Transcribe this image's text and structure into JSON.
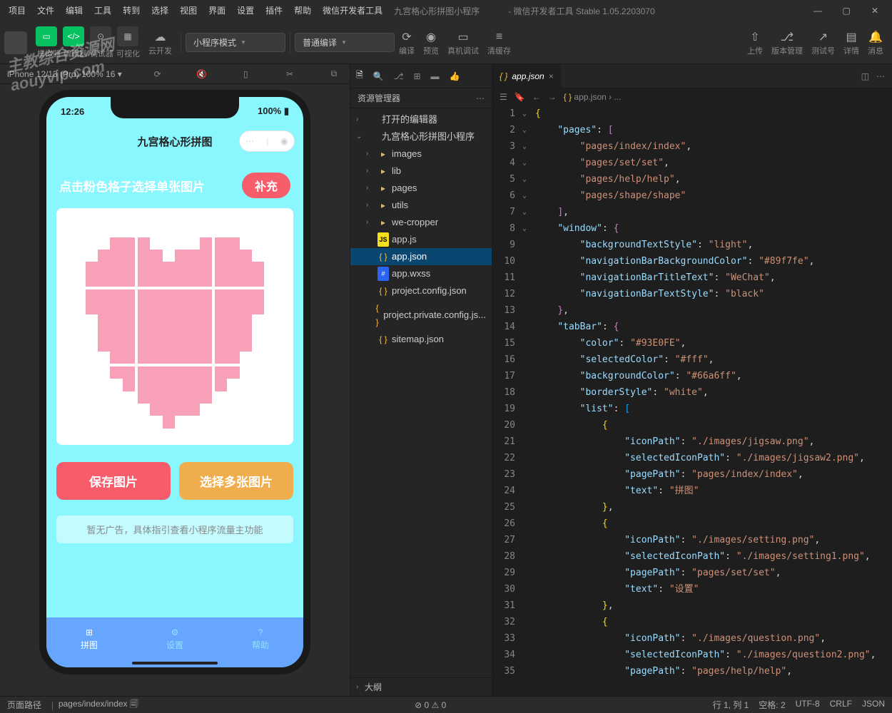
{
  "titlebar": {
    "menus": [
      "项目",
      "文件",
      "编辑",
      "工具",
      "转到",
      "选择",
      "视图",
      "界面",
      "设置",
      "插件",
      "帮助",
      "微信开发者工具"
    ],
    "projectName": "九宫格心形拼图小程序",
    "stable": "- 微信开发者工具 Stable 1.05.2203070"
  },
  "toolbar": {
    "modeLabels": [
      "模拟器",
      "编辑器",
      "调试器",
      "可视化"
    ],
    "cloudDev": "云开发",
    "programMode": "小程序模式",
    "compileMode": "普通编译",
    "actions": {
      "compile": "编译",
      "preview": "预览",
      "realDebug": "真机调试",
      "clearCache": "清缓存",
      "upload": "上传",
      "version": "版本管理",
      "testNum": "测试号",
      "details": "详情",
      "message": "消息"
    }
  },
  "sim": {
    "device": "iPhone 12/13 (Pro)",
    "zoom": "100% 16",
    "time": "12:26",
    "battery": "100%",
    "navTitle": "九宫格心形拼图",
    "hint": "点击粉色格子选择单张图片",
    "fillBtn": "补充",
    "saveBtn": "保存图片",
    "multiBtn": "选择多张图片",
    "adText": "暂无广告，具体指引查看小程序流量主功能",
    "tabs": [
      "拼图",
      "设置",
      "帮助"
    ]
  },
  "explorer": {
    "title": "资源管理器",
    "openEditors": "打开的编辑器",
    "projectRoot": "九宫格心形拼图小程序",
    "folders": [
      "images",
      "lib",
      "pages",
      "utils",
      "we-cropper"
    ],
    "files": [
      "app.js",
      "app.json",
      "app.wxss",
      "project.config.json",
      "project.private.config.js...",
      "sitemap.json"
    ],
    "outline": "大纲"
  },
  "editor": {
    "tabName": "app.json",
    "breadcrumbFile": "app.json",
    "breadcrumbMore": "..."
  },
  "code": {
    "lines": [
      [
        [
          "brace",
          "{"
        ]
      ],
      [
        [
          "sp",
          "    "
        ],
        [
          "key",
          "\"pages\""
        ],
        [
          "punc",
          ": "
        ],
        [
          "brace1",
          "["
        ]
      ],
      [
        [
          "sp",
          "        "
        ],
        [
          "str",
          "\"pages/index/index\""
        ],
        [
          "punc",
          ","
        ]
      ],
      [
        [
          "sp",
          "        "
        ],
        [
          "str",
          "\"pages/set/set\""
        ],
        [
          "punc",
          ","
        ]
      ],
      [
        [
          "sp",
          "        "
        ],
        [
          "str",
          "\"pages/help/help\""
        ],
        [
          "punc",
          ","
        ]
      ],
      [
        [
          "sp",
          "        "
        ],
        [
          "str",
          "\"pages/shape/shape\""
        ]
      ],
      [
        [
          "sp",
          "    "
        ],
        [
          "brace1",
          "]"
        ],
        [
          "punc",
          ","
        ]
      ],
      [
        [
          "sp",
          "    "
        ],
        [
          "key",
          "\"window\""
        ],
        [
          "punc",
          ": "
        ],
        [
          "brace1",
          "{"
        ]
      ],
      [
        [
          "sp",
          "        "
        ],
        [
          "key",
          "\"backgroundTextStyle\""
        ],
        [
          "punc",
          ": "
        ],
        [
          "str",
          "\"light\""
        ],
        [
          "punc",
          ","
        ]
      ],
      [
        [
          "sp",
          "        "
        ],
        [
          "key",
          "\"navigationBarBackgroundColor\""
        ],
        [
          "punc",
          ": "
        ],
        [
          "str",
          "\"#89f7fe\""
        ],
        [
          "punc",
          ","
        ]
      ],
      [
        [
          "sp",
          "        "
        ],
        [
          "key",
          "\"navigationBarTitleText\""
        ],
        [
          "punc",
          ": "
        ],
        [
          "str",
          "\"WeChat\""
        ],
        [
          "punc",
          ","
        ]
      ],
      [
        [
          "sp",
          "        "
        ],
        [
          "key",
          "\"navigationBarTextStyle\""
        ],
        [
          "punc",
          ": "
        ],
        [
          "str",
          "\"black\""
        ]
      ],
      [
        [
          "sp",
          "    "
        ],
        [
          "brace1",
          "}"
        ],
        [
          "punc",
          ","
        ]
      ],
      [
        [
          "sp",
          "    "
        ],
        [
          "key",
          "\"tabBar\""
        ],
        [
          "punc",
          ": "
        ],
        [
          "brace1",
          "{"
        ]
      ],
      [
        [
          "sp",
          "        "
        ],
        [
          "key",
          "\"color\""
        ],
        [
          "punc",
          ": "
        ],
        [
          "str",
          "\"#93E0FE\""
        ],
        [
          "punc",
          ","
        ]
      ],
      [
        [
          "sp",
          "        "
        ],
        [
          "key",
          "\"selectedColor\""
        ],
        [
          "punc",
          ": "
        ],
        [
          "str",
          "\"#fff\""
        ],
        [
          "punc",
          ","
        ]
      ],
      [
        [
          "sp",
          "        "
        ],
        [
          "key",
          "\"backgroundColor\""
        ],
        [
          "punc",
          ": "
        ],
        [
          "str",
          "\"#66a6ff\""
        ],
        [
          "punc",
          ","
        ]
      ],
      [
        [
          "sp",
          "        "
        ],
        [
          "key",
          "\"borderStyle\""
        ],
        [
          "punc",
          ": "
        ],
        [
          "str",
          "\"white\""
        ],
        [
          "punc",
          ","
        ]
      ],
      [
        [
          "sp",
          "        "
        ],
        [
          "key",
          "\"list\""
        ],
        [
          "punc",
          ": "
        ],
        [
          "brace2",
          "["
        ]
      ],
      [
        [
          "sp",
          "            "
        ],
        [
          "brace",
          "{"
        ]
      ],
      [
        [
          "sp",
          "                "
        ],
        [
          "key",
          "\"iconPath\""
        ],
        [
          "punc",
          ": "
        ],
        [
          "str",
          "\"./images/jigsaw.png\""
        ],
        [
          "punc",
          ","
        ]
      ],
      [
        [
          "sp",
          "                "
        ],
        [
          "key",
          "\"selectedIconPath\""
        ],
        [
          "punc",
          ": "
        ],
        [
          "str",
          "\"./images/jigsaw2.png\""
        ],
        [
          "punc",
          ","
        ]
      ],
      [
        [
          "sp",
          "                "
        ],
        [
          "key",
          "\"pagePath\""
        ],
        [
          "punc",
          ": "
        ],
        [
          "str",
          "\"pages/index/index\""
        ],
        [
          "punc",
          ","
        ]
      ],
      [
        [
          "sp",
          "                "
        ],
        [
          "key",
          "\"text\""
        ],
        [
          "punc",
          ": "
        ],
        [
          "str",
          "\"拼图\""
        ]
      ],
      [
        [
          "sp",
          "            "
        ],
        [
          "brace",
          "}"
        ],
        [
          "punc",
          ","
        ]
      ],
      [
        [
          "sp",
          "            "
        ],
        [
          "brace",
          "{"
        ]
      ],
      [
        [
          "sp",
          "                "
        ],
        [
          "key",
          "\"iconPath\""
        ],
        [
          "punc",
          ": "
        ],
        [
          "str",
          "\"./images/setting.png\""
        ],
        [
          "punc",
          ","
        ]
      ],
      [
        [
          "sp",
          "                "
        ],
        [
          "key",
          "\"selectedIconPath\""
        ],
        [
          "punc",
          ": "
        ],
        [
          "str",
          "\"./images/setting1.png\""
        ],
        [
          "punc",
          ","
        ]
      ],
      [
        [
          "sp",
          "                "
        ],
        [
          "key",
          "\"pagePath\""
        ],
        [
          "punc",
          ": "
        ],
        [
          "str",
          "\"pages/set/set\""
        ],
        [
          "punc",
          ","
        ]
      ],
      [
        [
          "sp",
          "                "
        ],
        [
          "key",
          "\"text\""
        ],
        [
          "punc",
          ": "
        ],
        [
          "str",
          "\"设置\""
        ]
      ],
      [
        [
          "sp",
          "            "
        ],
        [
          "brace",
          "}"
        ],
        [
          "punc",
          ","
        ]
      ],
      [
        [
          "sp",
          "            "
        ],
        [
          "brace",
          "{"
        ]
      ],
      [
        [
          "sp",
          "                "
        ],
        [
          "key",
          "\"iconPath\""
        ],
        [
          "punc",
          ": "
        ],
        [
          "str",
          "\"./images/question.png\""
        ],
        [
          "punc",
          ","
        ]
      ],
      [
        [
          "sp",
          "                "
        ],
        [
          "key",
          "\"selectedIconPath\""
        ],
        [
          "punc",
          ": "
        ],
        [
          "str",
          "\"./images/question2.png\""
        ],
        [
          "punc",
          ","
        ]
      ],
      [
        [
          "sp",
          "                "
        ],
        [
          "key",
          "\"pagePath\""
        ],
        [
          "punc",
          ": "
        ],
        [
          "str",
          "\"pages/help/help\""
        ],
        [
          "punc",
          ","
        ]
      ]
    ],
    "folds": {
      "1": "⌄",
      "2": "⌄",
      "8": "⌄",
      "14": "⌄",
      "19": "⌄",
      "20": "⌄",
      "26": "⌄",
      "32": "⌄"
    }
  },
  "statusbar": {
    "pathLabel": "页面路径",
    "pagePath": "pages/index/index",
    "errors": "⊘ 0 ⚠ 0",
    "cursor": "行 1, 列 1",
    "spaces": "空格: 2",
    "encoding": "UTF-8",
    "eol": "CRLF",
    "lang": "JSON"
  },
  "watermark": {
    "l1": "主教综合资源网",
    "l2": "aouyvip.com"
  }
}
